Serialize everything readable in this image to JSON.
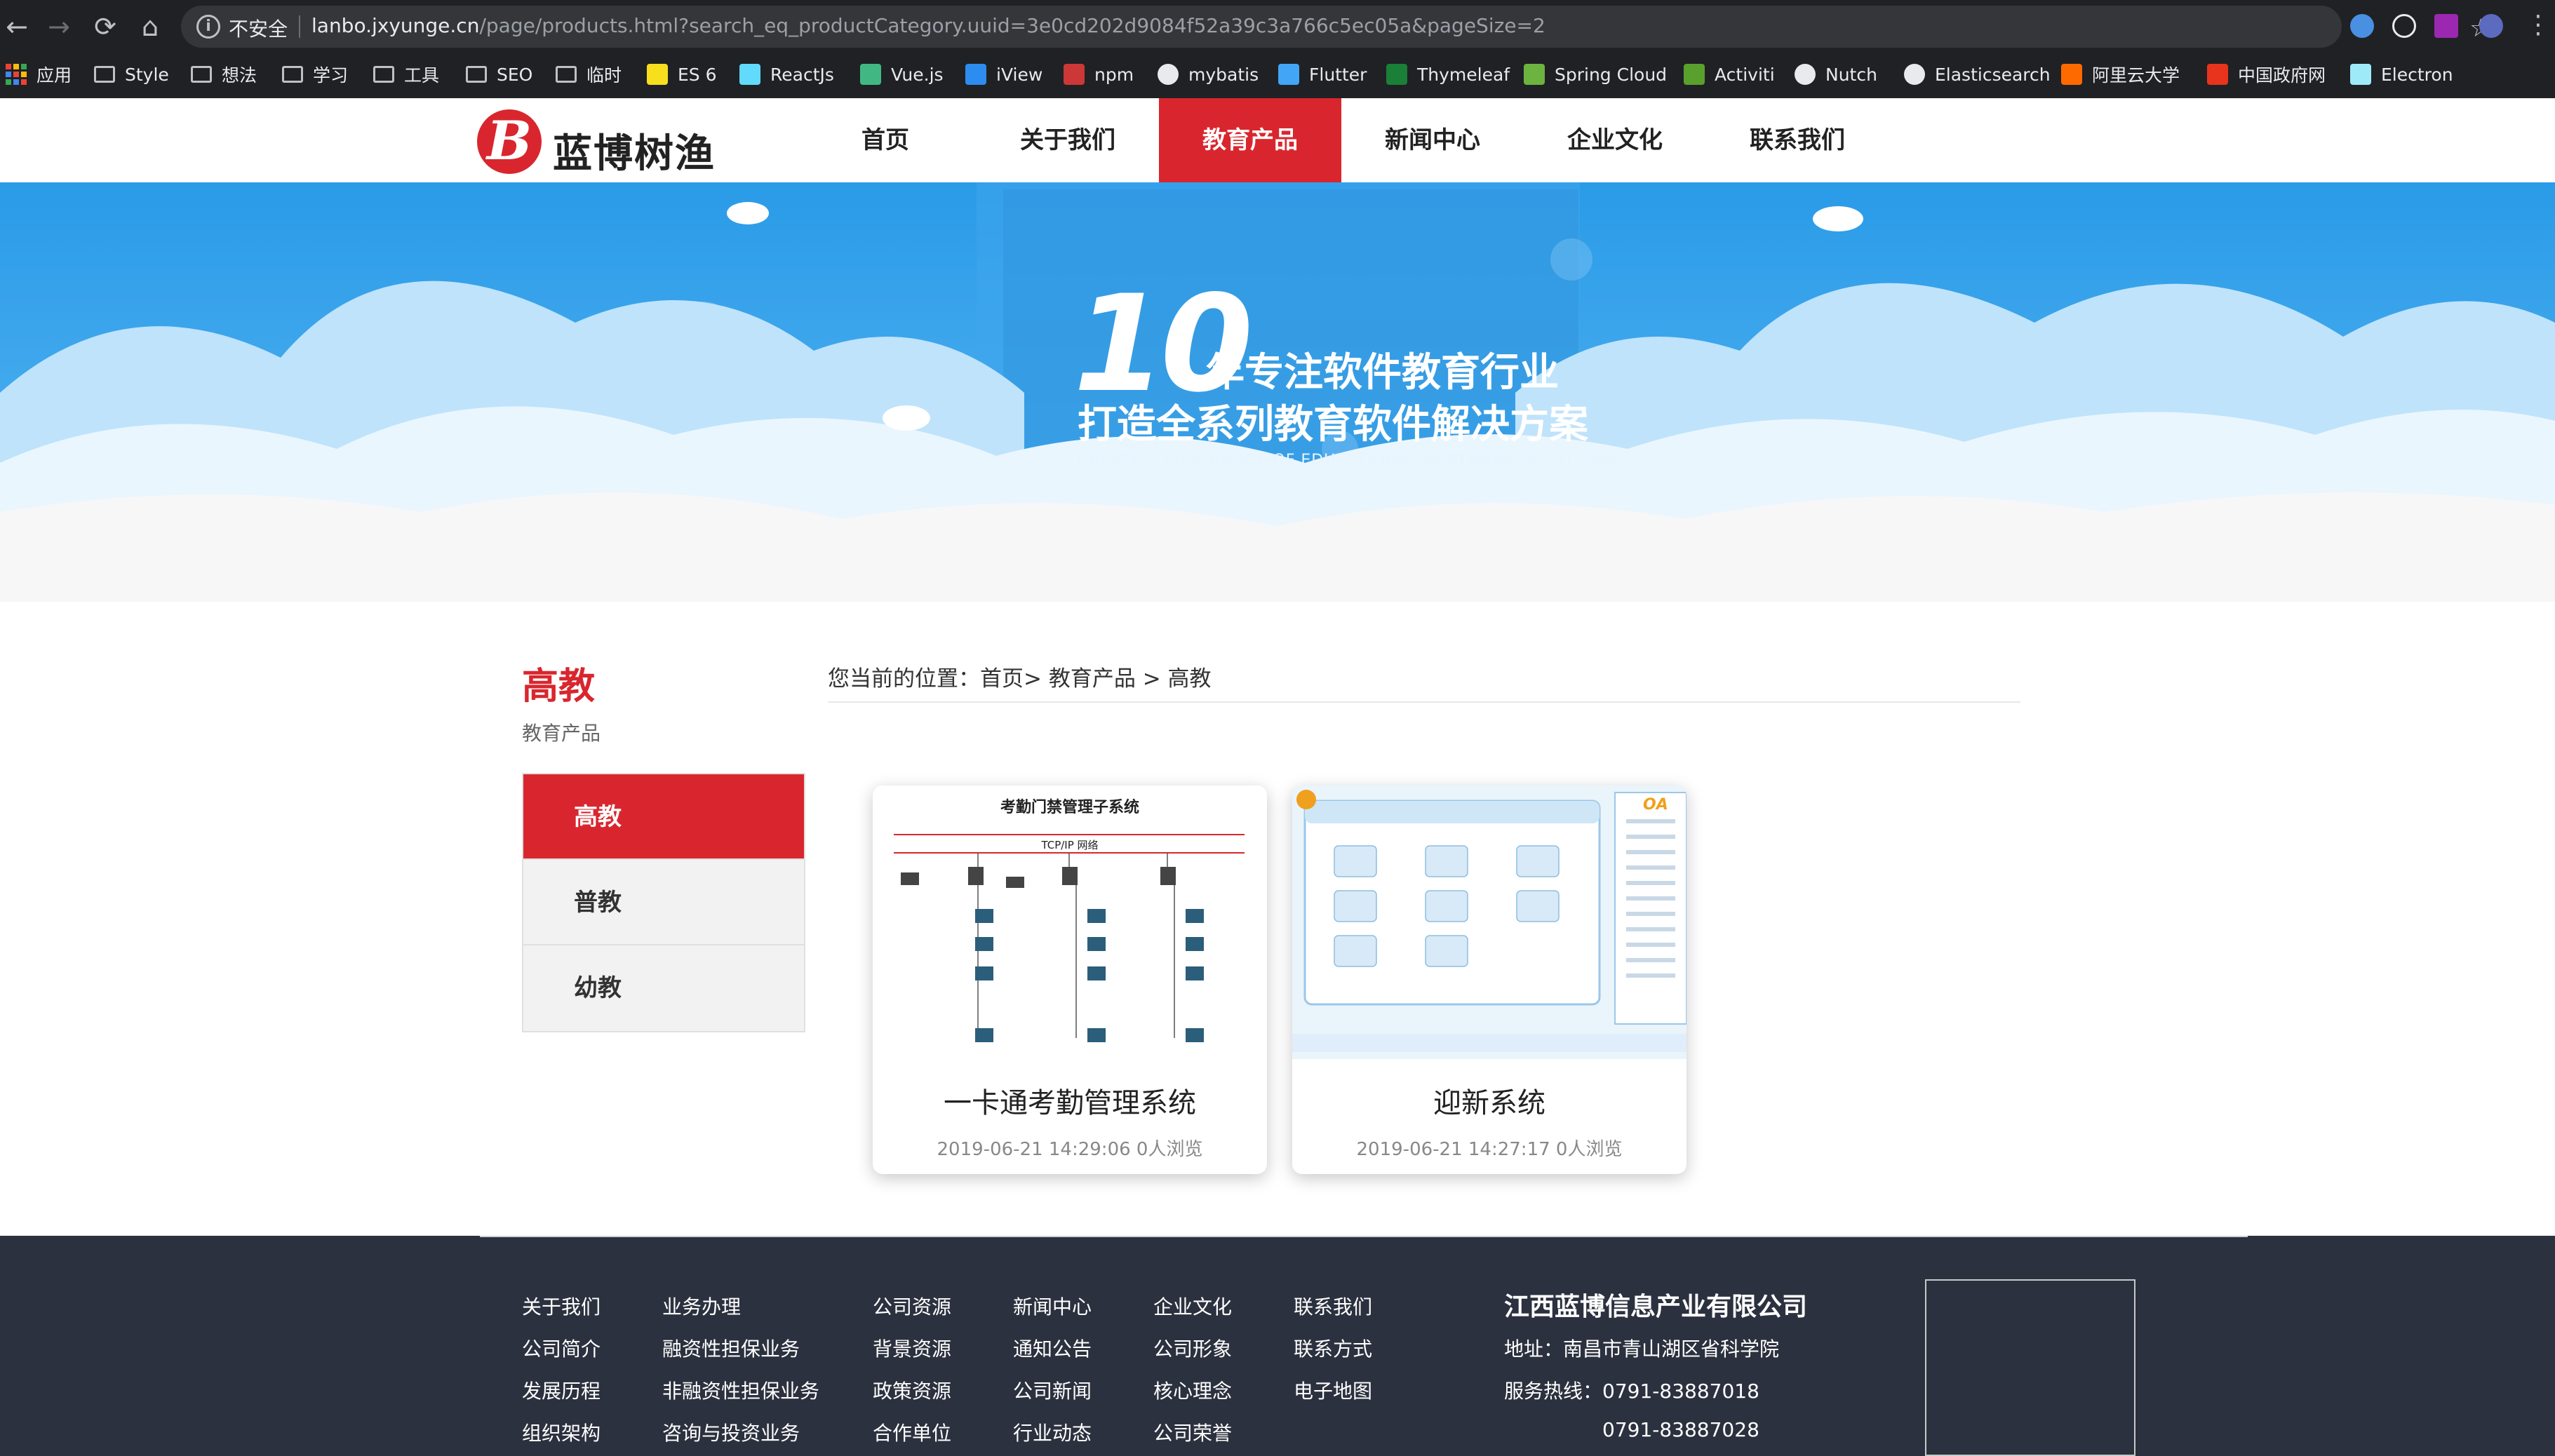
{
  "browser": {
    "insecure_label": "不安全",
    "url_domain": "lanbo.jxyunge.cn",
    "url_path": "/page/products.html?search_eq_productCategory.uuid=3e0cd202d9084f52a39c3a766c5ec05a&pageSize=2",
    "bookmarks": [
      {
        "label": "应用",
        "icon": "apps-grid-icon"
      },
      {
        "label": "Style",
        "icon": "folder-icon"
      },
      {
        "label": "想法",
        "icon": "folder-icon"
      },
      {
        "label": "学习",
        "icon": "folder-icon"
      },
      {
        "label": "工具",
        "icon": "folder-icon"
      },
      {
        "label": "SEO",
        "icon": "folder-icon"
      },
      {
        "label": "临时",
        "icon": "folder-icon"
      },
      {
        "label": "ES 6",
        "icon": "es6-icon",
        "color": "#f7df1e"
      },
      {
        "label": "ReactJs",
        "icon": "react-icon",
        "color": "#61dafb"
      },
      {
        "label": "Vue.js",
        "icon": "vue-icon",
        "color": "#41b883"
      },
      {
        "label": "iView",
        "icon": "iview-icon",
        "color": "#2d8cf0"
      },
      {
        "label": "npm",
        "icon": "npm-icon",
        "color": "#cb3837"
      },
      {
        "label": "mybatis",
        "icon": "globe-icon",
        "color": "#e8eaed"
      },
      {
        "label": "Flutter",
        "icon": "flutter-icon",
        "color": "#42a5f5"
      },
      {
        "label": "Thymeleaf",
        "icon": "thymeleaf-icon",
        "color": "#1a7f37"
      },
      {
        "label": "Spring Cloud",
        "icon": "spring-icon",
        "color": "#6db33f"
      },
      {
        "label": "Activiti",
        "icon": "activiti-icon",
        "color": "#5aa02c"
      },
      {
        "label": "Nutch",
        "icon": "globe-icon",
        "color": "#e8eaed"
      },
      {
        "label": "Elasticsearch",
        "icon": "globe-icon",
        "color": "#e8eaed"
      },
      {
        "label": "阿里云大学",
        "icon": "aliyun-icon",
        "color": "#ff6a00"
      },
      {
        "label": "中国政府网",
        "icon": "gov-emblem-icon",
        "color": "#e8341c"
      },
      {
        "label": "Electron",
        "icon": "electron-icon",
        "color": "#9feaf9"
      }
    ]
  },
  "site": {
    "logo_text": "蓝博树渔",
    "logo_mark": "B",
    "nav": [
      "首页",
      "关于我们",
      "教育产品",
      "新闻中心",
      "企业文化",
      "联系我们"
    ],
    "nav_active": "教育产品",
    "accent_color": "#d9262e"
  },
  "banner": {
    "number": "10",
    "line1": "年专注软件教育行业",
    "line2": "打造全系列教育软件解决方案",
    "line3": "CREATE A FULL RANGE OF EDUCATIONAL SOFTWARE SOLUTIONS"
  },
  "sidebar": {
    "title": "高教",
    "subtitle": "教育产品",
    "items": [
      {
        "label": "高教",
        "active": true
      },
      {
        "label": "普教",
        "active": false
      },
      {
        "label": "幼教",
        "active": false
      }
    ]
  },
  "breadcrumb": {
    "prefix": "您当前的位置：",
    "home": "首页",
    "section": "教育产品",
    "current": "高教",
    "text": "您当前的位置：首页> 教育产品 > 高教"
  },
  "products": [
    {
      "title": "一卡通考勤管理系统",
      "meta": "2019-06-21 14:29:06 0人浏览",
      "thumb": {
        "heading": "考勤门禁管理子系统",
        "network": "TCP/IP  网络"
      }
    },
    {
      "title": "迎新系统",
      "meta": "2019-06-21 14:27:17 0人浏览",
      "thumb": {
        "heading": "OA"
      }
    }
  ],
  "footer": {
    "columns": [
      [
        "关于我们",
        "公司简介",
        "发展历程",
        "组织架构"
      ],
      [
        "业务办理",
        "融资性担保业务",
        "非融资性担保业务",
        "咨询与投资业务"
      ],
      [
        "公司资源",
        "背景资源",
        "政策资源",
        "合作单位"
      ],
      [
        "新闻中心",
        "通知公告",
        "公司新闻",
        "行业动态"
      ],
      [
        "企业文化",
        "公司形象",
        "核心理念",
        "公司荣誉"
      ],
      [
        "联系我们",
        "联系方式",
        "电子地图"
      ]
    ],
    "company": "江西蓝博信息产业有限公司",
    "address": "地址：南昌市青山湖区省科学院",
    "hotline_label": "服务热线：",
    "hotline1": "0791-83887018",
    "hotline2": "0791-83887028"
  }
}
